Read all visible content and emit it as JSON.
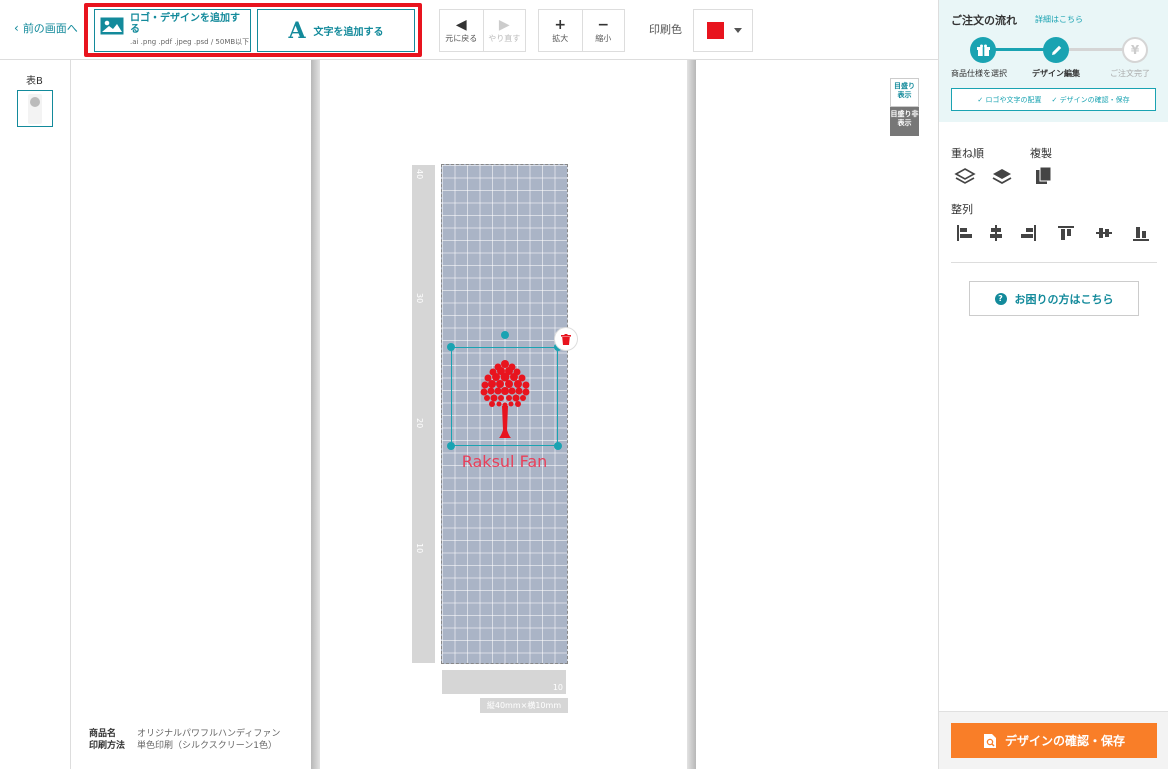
{
  "toolbar": {
    "back_label": "前の画面へ",
    "add_logo_title": "ロゴ・デザインを追加する",
    "add_logo_sub": ".ai .png .pdf .jpeg .psd / 50MB以下",
    "add_text_label": "文字を追加する",
    "undo_label": "元に戻る",
    "redo_label": "やり直す",
    "zoom_in_label": "拡大",
    "zoom_out_label": "縮小",
    "print_color_label": "印刷色",
    "print_color_value": "#e8141e"
  },
  "left": {
    "side_label": "表B"
  },
  "canvas": {
    "ruler_ticks": [
      "40",
      "30",
      "20",
      "10"
    ],
    "ruler_h_num": "10",
    "dimension_caption": "縦40mm×横10mm",
    "logo_text": "Raksul Fan",
    "grid_toggle_on": "目盛り表示",
    "grid_toggle_off": "目盛り非表示"
  },
  "product": {
    "name_key": "商品名",
    "name_value": "オリジナルパワフルハンディファン",
    "method_key": "印刷方法",
    "method_value": "単色印刷（シルクスクリーン1色）"
  },
  "right": {
    "flow_title": "ご注文の流れ",
    "flow_detail_link": "詳細はこちら",
    "steps": [
      {
        "label": "商品仕様を選択",
        "state": "done",
        "icon": "gift-icon"
      },
      {
        "label": "デザイン編集",
        "state": "current",
        "icon": "pencil-icon"
      },
      {
        "label": "ご注文完了",
        "state": "todo",
        "icon": "yen-icon"
      }
    ],
    "flow_sub_1": "✓ ロゴや文字の配置",
    "flow_sub_2": "✓ デザインの確認・保存",
    "order_label": "重ね順",
    "duplicate_label": "複製",
    "align_label": "整列",
    "help_label": "お困りの方はこちら",
    "save_label": "デザインの確認・保存"
  },
  "colors": {
    "accent": "#138a9b",
    "print_red": "#e8141e",
    "save_orange": "#f97e28"
  }
}
